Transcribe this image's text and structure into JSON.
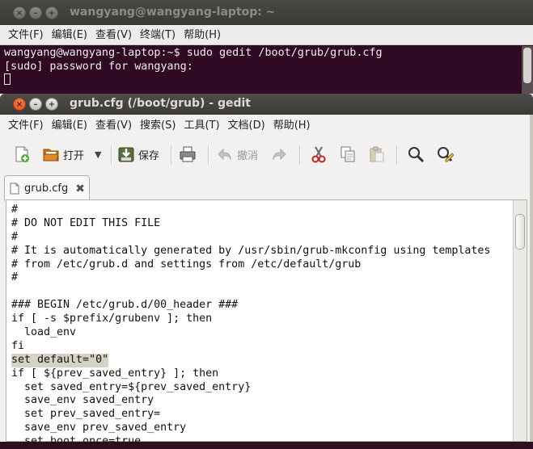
{
  "terminal": {
    "title": "wangyang@wangyang-laptop: ~",
    "menu": [
      "文件(F)",
      "编辑(E)",
      "查看(V)",
      "终端(T)",
      "帮助(H)"
    ],
    "lines": [
      "wangyang@wangyang-laptop:~$ sudo gedit /boot/grub/grub.cfg",
      "[sudo] password for wangyang: "
    ]
  },
  "gedit": {
    "title": "grub.cfg (/boot/grub) - gedit",
    "menu": [
      "文件(F)",
      "编辑(E)",
      "查看(V)",
      "搜索(S)",
      "工具(T)",
      "文档(D)",
      "帮助(H)"
    ],
    "toolbar": {
      "open_label": "打开",
      "save_label": "保存",
      "undo_label": "撤消"
    },
    "tab": {
      "label": "grub.cfg",
      "close_glyph": "✖"
    },
    "editor": {
      "lines": [
        "#",
        "# DO NOT EDIT THIS FILE",
        "#",
        "# It is automatically generated by /usr/sbin/grub-mkconfig using templates",
        "# from /etc/grub.d and settings from /etc/default/grub",
        "#",
        "",
        "### BEGIN /etc/grub.d/00_header ###",
        "if [ -s $prefix/grubenv ]; then",
        "  load_env",
        "fi",
        "set default=\"0\"",
        "if [ ${prev_saved_entry} ]; then",
        "  set saved_entry=${prev_saved_entry}",
        "  save_env saved_entry",
        "  set prev_saved_entry=",
        "  save_env prev_saved_entry",
        "  set boot_once=true"
      ],
      "highlighted_line_index": 11
    }
  },
  "colors": {
    "terminal_bg": "#300a24",
    "titlebar": "#3c3b37",
    "close_button": "#e14d1a",
    "line_highlight": "#d6d2c4"
  }
}
